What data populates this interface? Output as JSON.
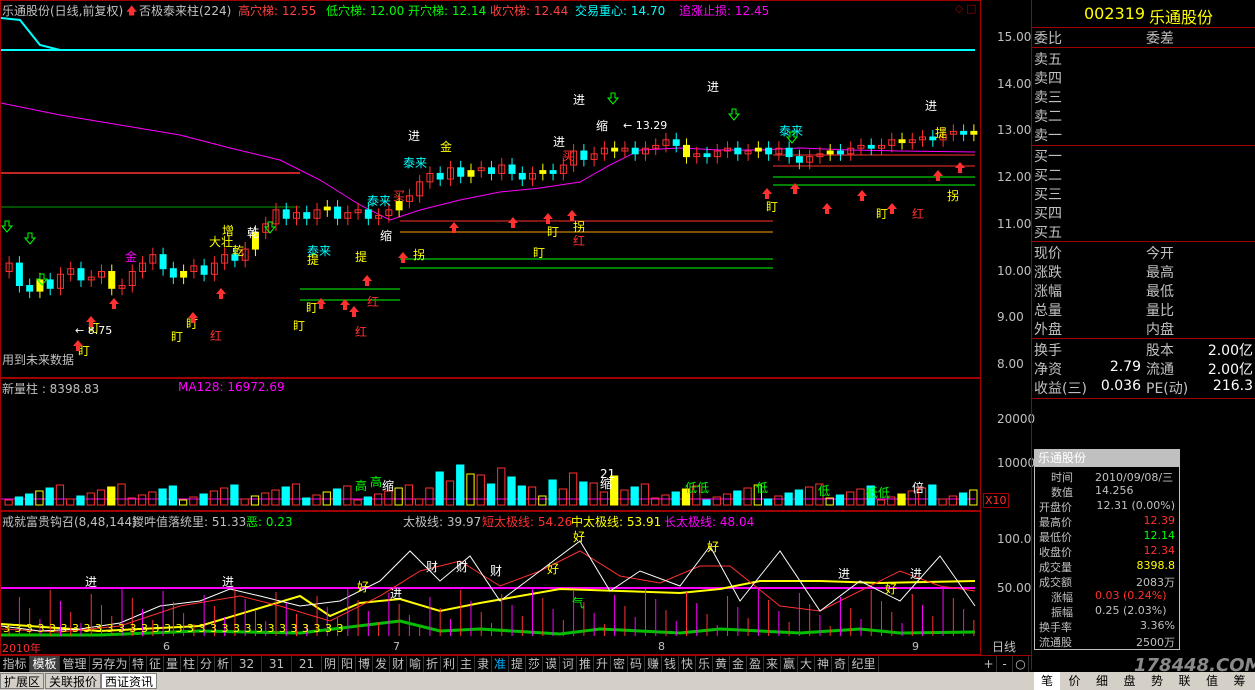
{
  "header": {
    "title": "乐通股份(日线,前复权)",
    "indicator_name": "否极泰来柱(224)",
    "items": [
      {
        "label": "高穴梯: 12.55",
        "color": "#ff4040"
      },
      {
        "label": "低穴梯: 12.00",
        "color": "#00ff00"
      },
      {
        "label": "开穴梯: 12.14",
        "color": "#00ff00"
      },
      {
        "label": "收穴梯: 12.44",
        "color": "#ff4040"
      },
      {
        "label": "交易重心: 14.70",
        "color": "#00ffff"
      },
      {
        "label": "追涨止损: 12.45",
        "color": "#ff00ff"
      }
    ]
  },
  "price_axis": [
    "15.00",
    "14.00",
    "13.00",
    "12.00",
    "11.00",
    "10.00",
    "9.00",
    "8.00"
  ],
  "chart_annotations": {
    "future_data_note": "用到未来数据",
    "price_mark_high": "13.29",
    "price_mark_low": "8.75",
    "signals": [
      "进",
      "进",
      "进",
      "进",
      "进",
      "进",
      "金",
      "金",
      "泰来",
      "泰来",
      "泰来",
      "泰来",
      "增",
      "大壮",
      "乾",
      "乾",
      "缩",
      "提",
      "提",
      "拐",
      "拐",
      "拐",
      "盯",
      "盯",
      "盯",
      "盯",
      "盯",
      "盯",
      "盯",
      "盯",
      "盯",
      "盯",
      "红",
      "红",
      "红",
      "红",
      "红",
      "买",
      "买",
      "缩",
      "提"
    ]
  },
  "volume_panel": {
    "title": "新量柱 : 8398.83",
    "ma_label": "MA128: 16972.69",
    "axis": [
      "20000",
      "10000"
    ],
    "multiplier": "X10",
    "labels": [
      "高",
      "高",
      "缩",
      "21",
      "缩",
      "低低",
      "低",
      "低",
      "低低",
      "倍",
      "倍"
    ]
  },
  "indicator_panel": {
    "title": "戒就富贵钩召(8,48,144)",
    "value1": "鍐吽值落统里: 51.33",
    "value2": "恶: 0.23",
    "tai": "太极线: 39.97",
    "duan": "短太极线: 54.26",
    "zhong": "中太极线: 53.91",
    "chang": "长太极线: 48.04",
    "axis": [
      "100.0",
      "50.00"
    ],
    "year_label": "2010年",
    "month_labels": [
      "6",
      "7",
      "8",
      "9"
    ],
    "labels": [
      "进",
      "进",
      "进",
      "进",
      "进",
      "好",
      "好",
      "好",
      "好",
      "好",
      "财",
      "财",
      "财",
      "气"
    ]
  },
  "tabs": [
    "指标",
    "模板",
    "管理",
    "另存为",
    "特",
    "征",
    "量",
    "柱",
    "分",
    "析",
    "32",
    "31",
    "21",
    "阴",
    "阳",
    "博",
    "发",
    "财",
    "喻",
    "折",
    "利",
    "主",
    "隶",
    "准",
    "提",
    "莎",
    "谟",
    "诃",
    "推",
    "升",
    "密",
    "码",
    "赚",
    "钱",
    "快",
    "乐",
    "黄",
    "金",
    "盈",
    "来",
    "赢",
    "大",
    "神",
    "奇",
    "纪里"
  ],
  "tabs_active": "模板",
  "tabs_blue": "准",
  "tab_controls": [
    "+",
    "-",
    "○"
  ],
  "bottom_strip": [
    "扩展区",
    "关联报价",
    "西证资讯"
  ],
  "period_label": "日线",
  "right_tabs": [
    "笔",
    "价",
    "细",
    "盘",
    "势",
    "联",
    "值",
    "筹"
  ],
  "watermark": "178448.COM",
  "stock": {
    "code": "002319",
    "name": "乐通股份",
    "weibi": "委比",
    "weicha": "委差",
    "sell": [
      "卖五",
      "卖四",
      "卖三",
      "卖二",
      "卖一"
    ],
    "buy": [
      "买一",
      "买二",
      "买三",
      "买四",
      "买五"
    ]
  },
  "quote_left": [
    "现价",
    "涨跌",
    "涨幅",
    "总量",
    "外盘"
  ],
  "quote_right": [
    "今开",
    "最高",
    "最低",
    "量比",
    "内盘"
  ],
  "fundamentals": [
    {
      "k1": "换手",
      "v1": "",
      "k2": "股本",
      "v2": "2.00亿"
    },
    {
      "k1": "净资",
      "v1": "2.79",
      "k2": "流通",
      "v2": "2.00亿"
    },
    {
      "k1": "收益(三)",
      "v1": "0.036",
      "k2": "PE(动)",
      "v2": "216.3"
    }
  ],
  "info_popup": {
    "title": "乐通股份",
    "rows": [
      {
        "k": "时间",
        "v": "2010/09/08/三",
        "c": "#c0c0c0",
        "center": true
      },
      {
        "k": "数值",
        "v": "14.256",
        "c": "#c0c0c0",
        "center": true
      },
      {
        "k": "开盘价",
        "v": "12.31 (0.00%)",
        "c": "#c0c0c0"
      },
      {
        "k": "最高价",
        "v": "12.39",
        "c": "#ff3030"
      },
      {
        "k": "最低价",
        "v": "12.14",
        "c": "#00ff00"
      },
      {
        "k": "收盘价",
        "v": "12.34",
        "c": "#ff3030"
      },
      {
        "k": "成交量",
        "v": "8398.8",
        "c": "#ffff00"
      },
      {
        "k": "成交额",
        "v": "2083万",
        "c": "#c0c0c0"
      },
      {
        "k": "涨幅",
        "v": "0.03 (0.24%)",
        "c": "#ff3030",
        "center": true
      },
      {
        "k": "振幅",
        "v": "0.25 (2.03%)",
        "c": "#c0c0c0",
        "center": true
      },
      {
        "k": "换手率",
        "v": "3.36%",
        "c": "#c0c0c0"
      },
      {
        "k": "流通股",
        "v": "2500万",
        "c": "#c0c0c0"
      }
    ]
  },
  "colors": {
    "up": "#ff3030",
    "down": "#00ffff",
    "frame": "#a00000",
    "ma": "#ff00ff",
    "center": "#00ffff"
  }
}
